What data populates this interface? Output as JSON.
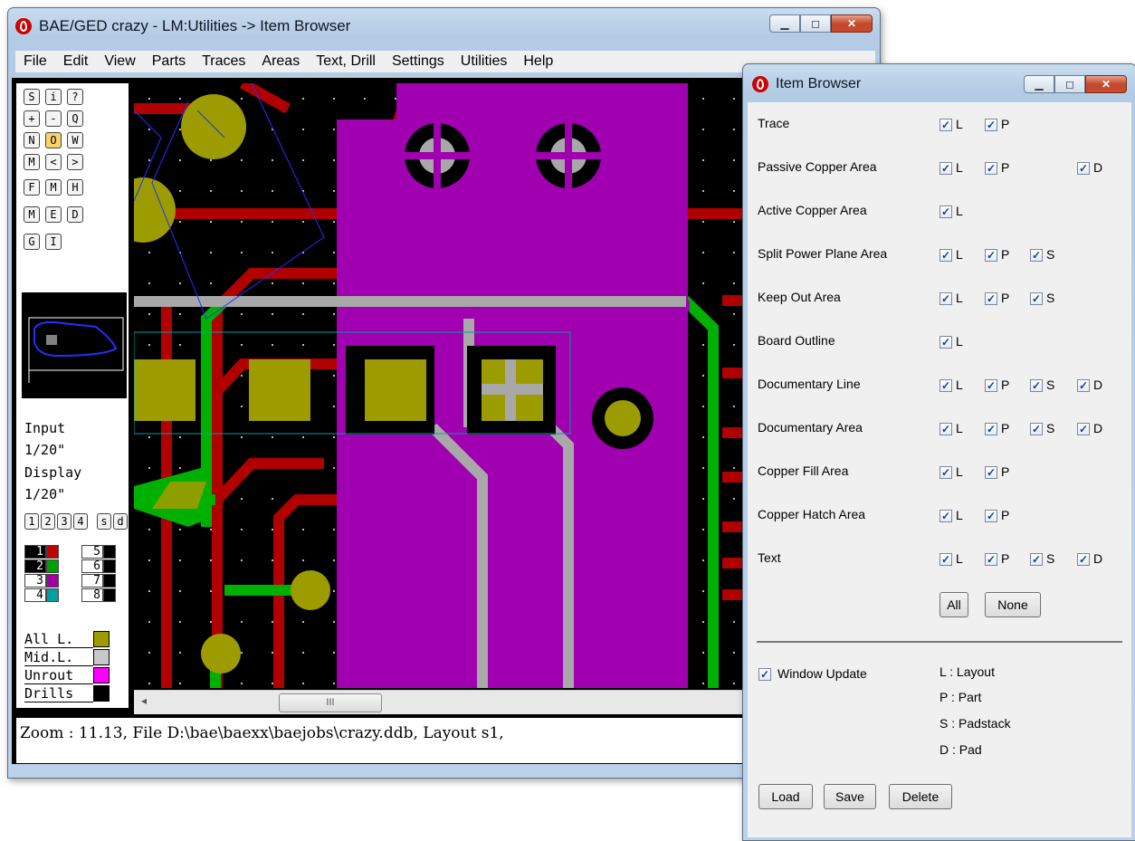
{
  "main_window": {
    "title": "BAE/GED crazy - LM:Utilities -> Item Browser",
    "menu": [
      "File",
      "Edit",
      "View",
      "Parts",
      "Traces",
      "Areas",
      "Text, Drill",
      "Settings",
      "Utilities",
      "Help"
    ],
    "toolbar_rows": [
      [
        "S",
        "i",
        "?"
      ],
      [
        "+",
        "-",
        "Q"
      ],
      [
        "N",
        "O",
        "W"
      ],
      [
        "M",
        "<",
        ">"
      ],
      [
        "F",
        "M",
        "H"
      ],
      [
        "M",
        "E",
        "D"
      ],
      [
        "G",
        "I"
      ]
    ],
    "input_label": "Input",
    "input_value": "1/20\"",
    "display_label": "Display",
    "display_value": "1/20\"",
    "mode_buttons": [
      "1",
      "2",
      "3",
      "4",
      "s",
      "d"
    ],
    "layers_left": [
      {
        "num": "1",
        "color": "#c00000"
      },
      {
        "num": "2",
        "color": "#00a000"
      },
      {
        "num": "3",
        "color": "#a000a0"
      },
      {
        "num": "4",
        "color": "#00a0a0"
      }
    ],
    "layers_right": [
      {
        "num": "5",
        "color": "#000000"
      },
      {
        "num": "6",
        "color": "#000000"
      },
      {
        "num": "7",
        "color": "#000000"
      },
      {
        "num": "8",
        "color": "#000000"
      }
    ],
    "legend": [
      {
        "label": "All L.",
        "color": "#9c9c00"
      },
      {
        "label": "Mid.L.",
        "color": "#c8c8c8"
      },
      {
        "label": "Unrout",
        "color": "#ff00ff"
      },
      {
        "label": "Drills",
        "color": "#000000"
      }
    ],
    "scroll_grip": "III",
    "scroll_left_arrow": "◂",
    "status": "Zoom : 11.13, File D:\\bae\\baexx\\baejobs\\crazy.ddb, Layout s1, "
  },
  "item_browser": {
    "title": "Item Browser",
    "rows": [
      {
        "label": "Trace",
        "checks": [
          "L",
          "P"
        ]
      },
      {
        "label": "Passive Copper Area",
        "checks": [
          "L",
          "P",
          "",
          "D"
        ]
      },
      {
        "label": "Active Copper Area",
        "checks": [
          "L"
        ]
      },
      {
        "label": "Split Power Plane Area",
        "checks": [
          "L",
          "P",
          "S"
        ]
      },
      {
        "label": "Keep Out Area",
        "checks": [
          "L",
          "P",
          "S"
        ]
      },
      {
        "label": "Board Outline",
        "checks": [
          "L"
        ]
      },
      {
        "label": "Documentary Line",
        "checks": [
          "L",
          "P",
          "S",
          "D"
        ]
      },
      {
        "label": "Documentary Area",
        "checks": [
          "L",
          "P",
          "S",
          "D"
        ]
      },
      {
        "label": "Copper Fill Area",
        "checks": [
          "L",
          "P"
        ]
      },
      {
        "label": "Copper Hatch Area",
        "checks": [
          "L",
          "P"
        ]
      },
      {
        "label": "Text",
        "checks": [
          "L",
          "P",
          "S",
          "D"
        ]
      }
    ],
    "all_button": "All",
    "none_button": "None",
    "window_update_label": "Window Update",
    "key": [
      "L : Layout",
      "P : Part",
      "S : Padstack",
      "D : Pad"
    ],
    "load_button": "Load",
    "save_button": "Save",
    "delete_button": "Delete"
  },
  "colors": {
    "trace_red": "#b00000",
    "trace_green": "#00b000",
    "copper_purple": "#a000b0",
    "pad_olive": "#a0a000",
    "mid_gray": "#a8a8a8"
  }
}
